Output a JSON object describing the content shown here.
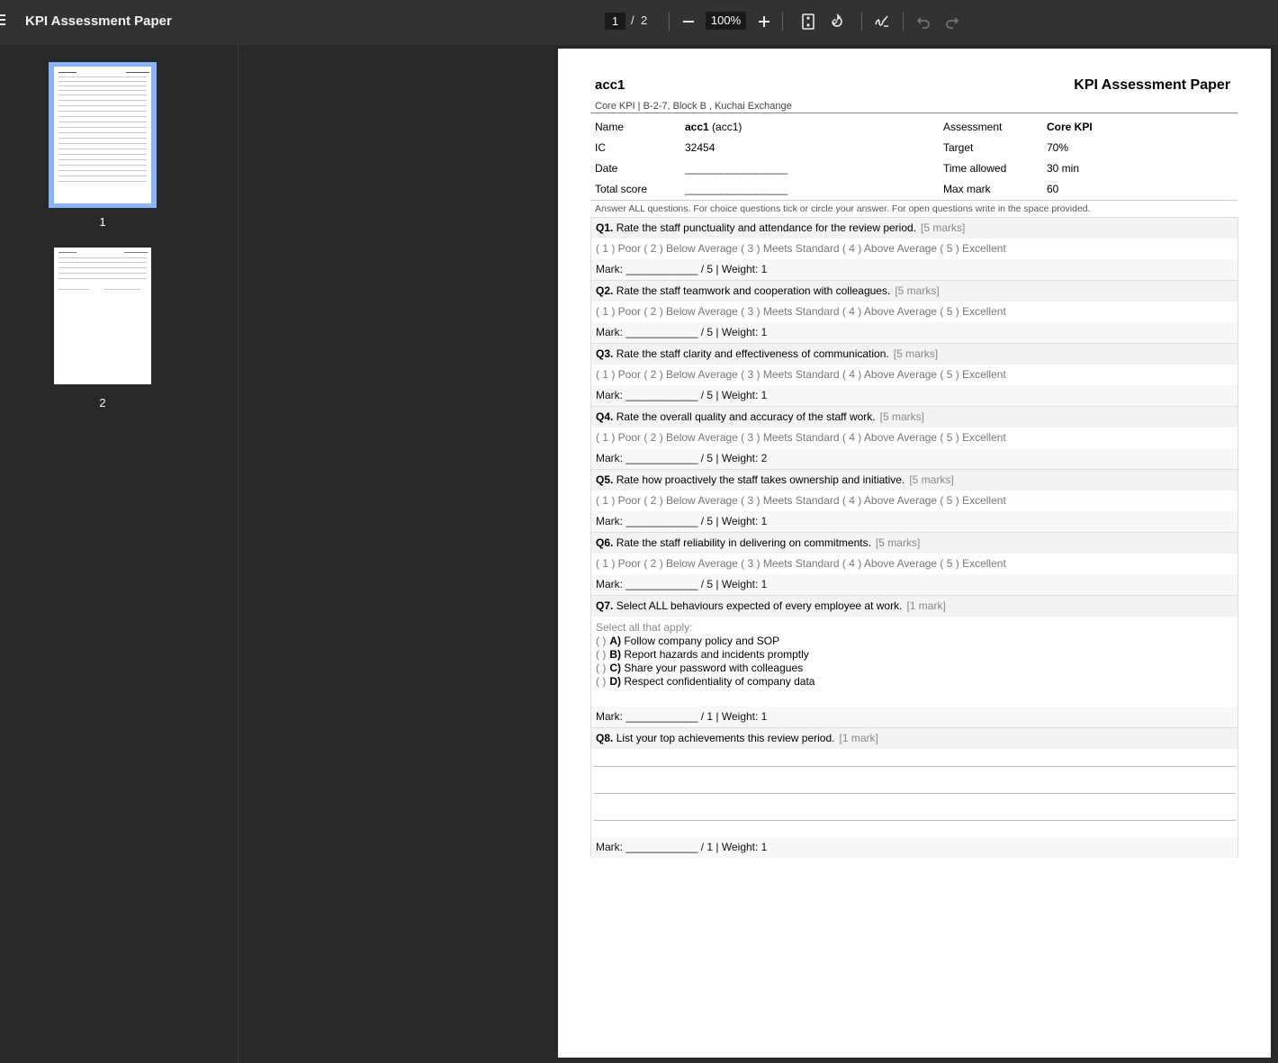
{
  "toolbar": {
    "title": "KPI Assessment Paper",
    "current_page": "1",
    "page_sep": "/",
    "total_pages": "2",
    "zoom": "100%"
  },
  "thumbnails": [
    {
      "label": "1",
      "active": true
    },
    {
      "label": "2",
      "active": false
    }
  ],
  "paper": {
    "name_title": "acc1",
    "doc_title": "KPI Assessment Paper",
    "subtitle": "Core KPI | B-2-7, Block B , Kuchai Exchange",
    "fields": {
      "name_label": "Name",
      "name_value_bold": "acc1",
      "name_value_rest": " (acc1)",
      "ic_label": "IC",
      "ic_value": "32454",
      "date_label": "Date",
      "date_value": "____________________",
      "total_label": "Total score",
      "total_value": "____________________",
      "assessment_label": "Assessment",
      "assessment_value": "Core KPI",
      "target_label": "Target",
      "target_value": "70%",
      "time_label": "Time allowed",
      "time_value": "30 min",
      "max_label": "Max mark",
      "max_value": "60"
    },
    "instructions": "Answer ALL questions. For choice questions tick or circle your answer. For open questions write in the space provided.",
    "questions": [
      {
        "num": "Q1.",
        "text": "Rate the staff punctuality and attendance for the review period.",
        "marks": "[5 marks]",
        "scale": "( 1 ) Poor ( 2 ) Below Average ( 3 ) Meets Standard ( 4 ) Above Average ( 5 ) Excellent",
        "mark_line": "Mark: ____________ / 5  |  Weight: 1"
      },
      {
        "num": "Q2.",
        "text": "Rate the staff teamwork and cooperation with colleagues.",
        "marks": "[5 marks]",
        "scale": "( 1 ) Poor ( 2 ) Below Average ( 3 ) Meets Standard ( 4 ) Above Average ( 5 ) Excellent",
        "mark_line": "Mark: ____________ / 5  |  Weight: 1"
      },
      {
        "num": "Q3.",
        "text": "Rate the staff clarity and effectiveness of communication.",
        "marks": "[5 marks]",
        "scale": "( 1 ) Poor ( 2 ) Below Average ( 3 ) Meets Standard ( 4 ) Above Average ( 5 ) Excellent",
        "mark_line": "Mark: ____________ / 5  |  Weight: 1"
      },
      {
        "num": "Q4.",
        "text": "Rate the overall quality and accuracy of the staff work.",
        "marks": "[5 marks]",
        "scale": "( 1 ) Poor ( 2 ) Below Average ( 3 ) Meets Standard ( 4 ) Above Average ( 5 ) Excellent",
        "mark_line": "Mark: ____________ / 5  |  Weight: 2"
      },
      {
        "num": "Q5.",
        "text": "Rate how proactively the staff takes ownership and initiative.",
        "marks": "[5 marks]",
        "scale": "( 1 ) Poor ( 2 ) Below Average ( 3 ) Meets Standard ( 4 ) Above Average ( 5 ) Excellent",
        "mark_line": "Mark: ____________ / 5  |  Weight: 1"
      },
      {
        "num": "Q6.",
        "text": "Rate the staff reliability in delivering on commitments.",
        "marks": "[5 marks]",
        "scale": "( 1 ) Poor ( 2 ) Below Average ( 3 ) Meets Standard ( 4 ) Above Average ( 5 ) Excellent",
        "mark_line": "Mark: ____________ / 5  |  Weight: 1"
      }
    ],
    "q7": {
      "num": "Q7.",
      "text": "Select ALL behaviours expected of every employee at work.",
      "marks": "[1 mark]",
      "hint": "Select all that apply:",
      "options": [
        {
          "par": "(   )",
          "key": "A)",
          "text": "Follow company policy and SOP"
        },
        {
          "par": "(   )",
          "key": "B)",
          "text": "Report hazards and incidents promptly"
        },
        {
          "par": "(   )",
          "key": "C)",
          "text": "Share your password with colleagues"
        },
        {
          "par": "(   )",
          "key": "D)",
          "text": "Respect confidentiality of company data"
        }
      ],
      "mark_line": "Mark: ____________ / 1  |  Weight: 1"
    },
    "q8": {
      "num": "Q8.",
      "text": "List your top achievements this review period.",
      "marks": "[1 mark]",
      "mark_line": "Mark: ____________ / 1  |  Weight: 1"
    }
  }
}
